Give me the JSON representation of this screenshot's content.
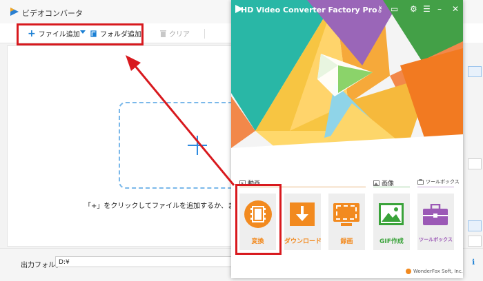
{
  "background_app": {
    "title": "ビデオコンバータ",
    "toolbar": {
      "add_file_label": "ファイル追加",
      "add_folder_label": "フォルダ追加",
      "clear_label": "クリア"
    },
    "drop_hint": "「+」をクリックしてファイルを追加するか、またはファイ",
    "output_folder": {
      "label": "出力フォルダ：",
      "value": "D:¥"
    }
  },
  "foreground_app": {
    "title": "HD Video Converter Factory Pro",
    "header_icons": [
      "key-icon",
      "cart-icon",
      "settings-icon",
      "menu-icon",
      "minimize-icon",
      "close-icon"
    ],
    "sections": {
      "video": "動画",
      "image": "画像",
      "toolbox": "ツールボックス"
    },
    "tiles": [
      {
        "name": "convert",
        "label": "変換",
        "icon": "film-icon",
        "color": "#f28a1f"
      },
      {
        "name": "download",
        "label": "ダウンロード",
        "icon": "download-icon",
        "color": "#f28a1f"
      },
      {
        "name": "record",
        "label": "録画",
        "icon": "screen-record-icon",
        "color": "#f28a1f"
      },
      {
        "name": "gif-maker",
        "label": "GIF作成",
        "icon": "image-icon",
        "color": "#3aa33a"
      },
      {
        "name": "toolbox",
        "label": "ツールボックス",
        "icon": "toolbox-icon",
        "color": "#9b59b6"
      }
    ],
    "footer": "WonderFox Soft, Inc."
  },
  "colors": {
    "annotation_red": "#d8191e",
    "orange": "#f28a1f",
    "green": "#3aa33a",
    "purple": "#9b59b6",
    "blue": "#1a7fd4"
  }
}
